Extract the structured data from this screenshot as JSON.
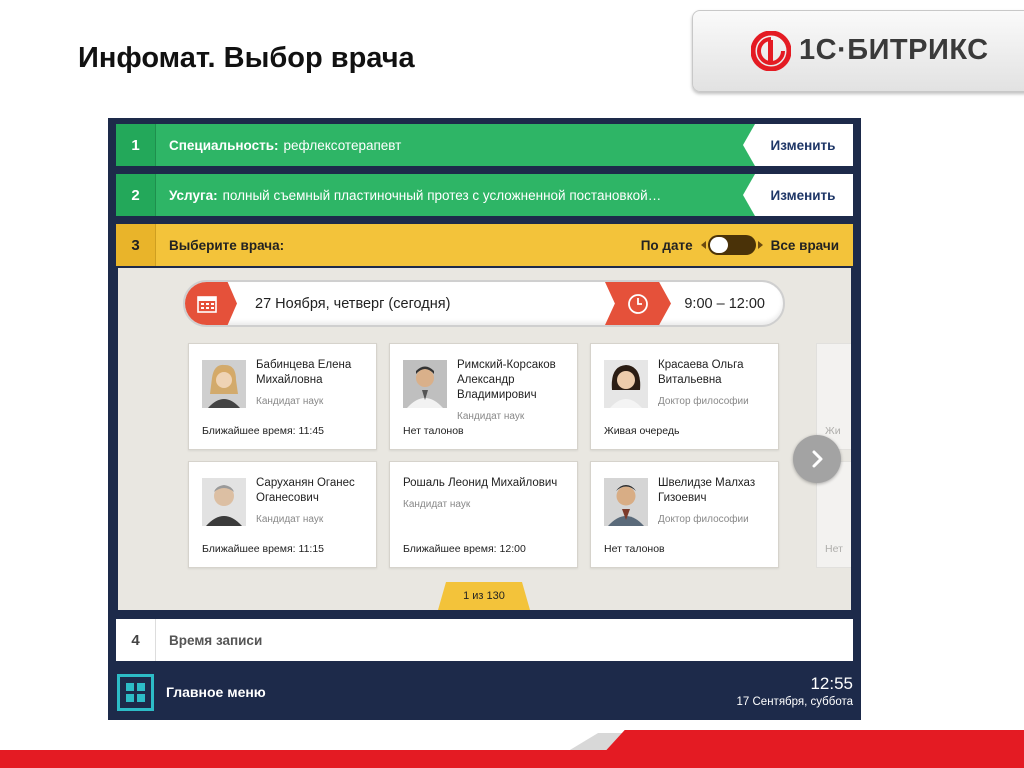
{
  "slide": {
    "title": "Инфомат. Выбор врача"
  },
  "brand": {
    "logo_text": "1С·БИТРИКС",
    "accent": "#e41b23"
  },
  "steps": {
    "s1": {
      "num": "1",
      "label": "Специальность:",
      "value": "рефлексотерапевт",
      "change": "Изменить"
    },
    "s2": {
      "num": "2",
      "label": "Услуга:",
      "value": "полный съемный пластиночный протез с усложненной постановкой…",
      "change": "Изменить"
    },
    "s3": {
      "num": "3",
      "label": "Выберите врача:",
      "toggle_left": "По дате",
      "toggle_right": "Все врачи"
    },
    "s4": {
      "num": "4",
      "label": "Время записи"
    }
  },
  "datebar": {
    "date": "27 Ноября, четверг (сегодня)",
    "time": "9:00 – 12:00"
  },
  "doctors": [
    {
      "name": "Бабинцева Елена Михайловна",
      "degree": "Кандидат наук",
      "nearest": "Ближайшее время: 11:45"
    },
    {
      "name": "Римский-Корсаков Александр Владимирович",
      "degree": "Кандидат наук",
      "nearest": "Нет талонов"
    },
    {
      "name": "Красаева Ольга Витальевна",
      "degree": "Доктор философии",
      "nearest": "Живая очередь"
    },
    {
      "name": "Саруханян Оганес Оганесович",
      "degree": "Кандидат наук",
      "nearest": "Ближайшее время: 11:15"
    },
    {
      "name": "Рошаль Леонид Михайлович",
      "degree": "Кандидат наук",
      "nearest": "Ближайшее время: 12:00"
    },
    {
      "name": "Швелидзе Малхаз Гизоевич",
      "degree": "Доктор философии",
      "nearest": "Нет талонов"
    }
  ],
  "ghost": {
    "top": "Жи",
    "bottom": "Нет"
  },
  "pager": {
    "text": "1 из 130"
  },
  "footer": {
    "menu_label": "Главное меню",
    "time": "12:55",
    "date": "17 Сентября, суббота"
  },
  "colors": {
    "navy": "#1d2a4a",
    "green": "#2eb566",
    "yellow": "#f3c33a",
    "red_orange": "#e5513a",
    "teal": "#2dbcc7"
  },
  "icons": {
    "calendar": "calendar-icon",
    "clock": "clock-icon",
    "next": "chevron-right-icon",
    "menu": "grid-menu-icon"
  }
}
